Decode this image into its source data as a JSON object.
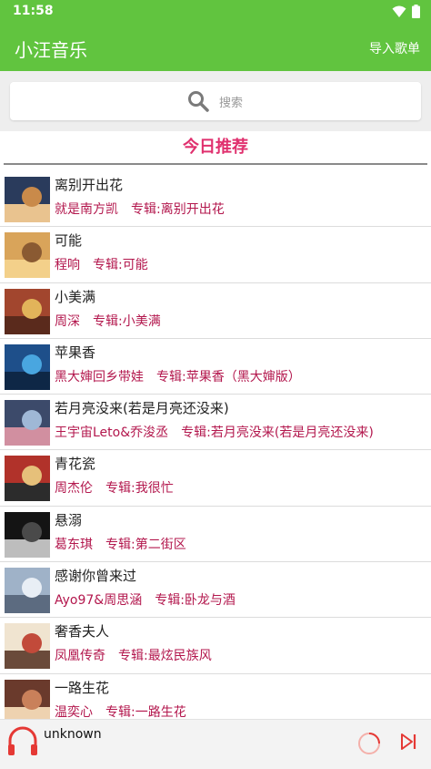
{
  "status_bar": {
    "time": "11:58"
  },
  "app_bar": {
    "title": "小汪音乐",
    "import_label": "导入歌单"
  },
  "search": {
    "placeholder": "搜索"
  },
  "section": {
    "title": "今日推荐"
  },
  "colors": {
    "brand": "#61c43f",
    "accent": "#e0306e",
    "meta": "#b3174d"
  },
  "songs": [
    {
      "name": "离别开出花",
      "artist": "就是南方凯",
      "album": "专辑:离别开出花",
      "cover_colors": [
        "#2a3b5c",
        "#c98a4a",
        "#e9c38f"
      ]
    },
    {
      "name": "可能",
      "artist": "程响",
      "album": "专辑:可能",
      "cover_colors": [
        "#d9a45a",
        "#8a5a32",
        "#f3d08a"
      ]
    },
    {
      "name": "小美满",
      "artist": "周深",
      "album": "专辑:小美满",
      "cover_colors": [
        "#a2462e",
        "#e2b45a",
        "#5a2a1c"
      ]
    },
    {
      "name": "苹果香",
      "artist": "黑大婶回乡带娃",
      "album": "专辑:苹果香（黑大婶版）",
      "cover_colors": [
        "#1e4f8a",
        "#49a6e0",
        "#0e2746"
      ]
    },
    {
      "name": "若月亮没来(若是月亮还没来)",
      "artist": "王宇宙Leto&乔浚丞",
      "album": "专辑:若月亮没来(若是月亮还没来)",
      "cover_colors": [
        "#3c4a6a",
        "#9fb8d6",
        "#d18fa0"
      ]
    },
    {
      "name": "青花瓷",
      "artist": "周杰伦",
      "album": "专辑:我很忙",
      "cover_colors": [
        "#b1322a",
        "#e6c07a",
        "#2c2c2c"
      ]
    },
    {
      "name": "悬溺",
      "artist": "葛东琪",
      "album": "专辑:第二街区",
      "cover_colors": [
        "#141414",
        "#4a4a4a",
        "#bdbdbd"
      ]
    },
    {
      "name": "感谢你曾来过",
      "artist": "Ayo97&周思涵",
      "album": "专辑:卧龙与酒",
      "cover_colors": [
        "#9fb2c8",
        "#e8eef5",
        "#5c6b80"
      ]
    },
    {
      "name": "奢香夫人",
      "artist": "凤凰传奇",
      "album": "专辑:最炫民族风",
      "cover_colors": [
        "#f0e4d0",
        "#c24a3a",
        "#6a4a3a"
      ]
    },
    {
      "name": "一路生花",
      "artist": "温奕心",
      "album": "专辑:一路生花",
      "cover_colors": [
        "#6a3a2c",
        "#c9805a",
        "#eed2b0"
      ]
    }
  ],
  "player": {
    "song": "unknown"
  }
}
